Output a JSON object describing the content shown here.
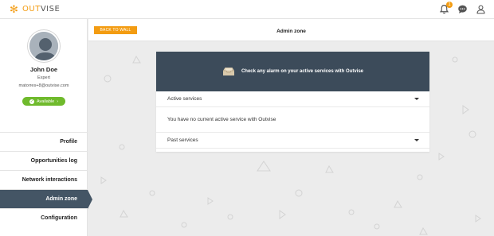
{
  "app": {
    "logo_text_prefix": "OUT",
    "logo_text_suffix": "VISE",
    "notification_count": "1",
    "brand_color": "#f39c12"
  },
  "user": {
    "name": "John Doe",
    "role": "Expert",
    "email": "matorres+8@outvise.com",
    "status_label": "Available",
    "status_color": "#6fba2c"
  },
  "sidebar": {
    "items": [
      {
        "label": "Profile"
      },
      {
        "label": "Opportunities log"
      },
      {
        "label": "Network interactions"
      },
      {
        "label": "Admin zone"
      },
      {
        "label": "Configuration"
      }
    ],
    "active_color": "#445565"
  },
  "header": {
    "back_label": "BACK TO WALL",
    "title": "Admin zone"
  },
  "card": {
    "banner_text": "Check any alarm on your active services with Outvise",
    "active_section": "Active services",
    "empty_message": "You have no current active service with Outvise",
    "past_section": "Past services"
  },
  "icons": [
    "outvise-logo-icon",
    "bell-icon",
    "chat-icon",
    "user-icon",
    "check-icon",
    "chevron-right-icon",
    "inbox-icon",
    "caret-down-icon"
  ]
}
